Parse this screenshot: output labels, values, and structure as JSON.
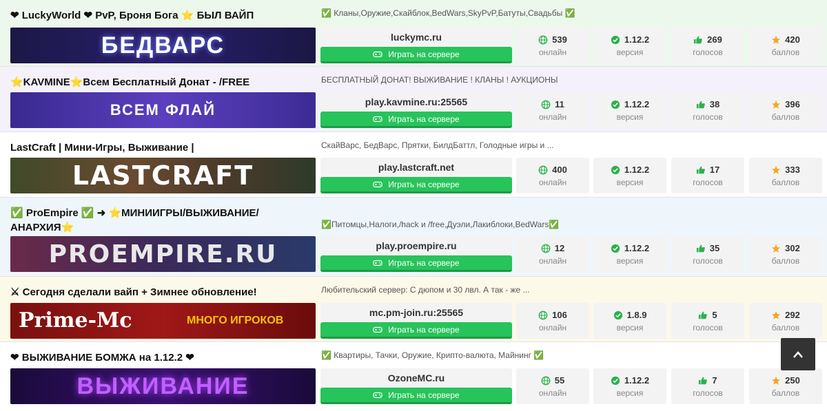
{
  "play_label": "Играть на сервере",
  "labels": {
    "online": "онлайн",
    "version": "версия",
    "votes": "голосов",
    "points": "баллов"
  },
  "colors": {
    "green": "#27c35b",
    "row1_bg": "#edf8ed",
    "row2_bg": "#f5f1fb",
    "row4_bg": "#eef6fb",
    "row5_bg": "#fdf9e8"
  },
  "servers": [
    {
      "title": "❤ LuckyWorld ❤ PvP, Броня Бога ⭐ БЫЛ ВАЙП",
      "desc": "✅ Кланы,Оружие,Скайблок,BedWars,SkyPvP,Батуты,Свадьбы ✅",
      "banner_text": "БЕДВАРС",
      "ip": "luckymc.ru",
      "online": "539",
      "version": "1.12.2",
      "votes": "269",
      "points": "420"
    },
    {
      "title": "⭐KAVMINE⭐Всем Бесплатный Донат - /FREE",
      "desc": "БЕСПЛАТНЫЙ ДОНАТ! ВЫЖИВАНИЕ ! КЛАНЫ ! АУКЦИОНЫ",
      "banner_text": "ВСЕМ ФЛАЙ",
      "ip": "play.kavmine.ru:25565",
      "online": "11",
      "version": "1.12.2",
      "votes": "38",
      "points": "396"
    },
    {
      "title": "LastCraft | Мини-Игры, Выживание |",
      "desc": "СкайВарс, БедВарс, Прятки, БилдБаттл, Голодные игры и ...",
      "banner_text": "LASTCRAFT",
      "ip": "play.lastcraft.net",
      "online": "400",
      "version": "1.12.2",
      "votes": "17",
      "points": "333"
    },
    {
      "title": "✅ ProEmpire ✅ ➜ ⭐МИНИИГРЫ/ВЫЖИВАНИЕ/ АНАРХИЯ⭐",
      "desc": "✅Питомцы,Налоги,/hack и /free,Дуэли,Лакиблоки,BedWars✅",
      "banner_text": "PROEMPIRE.RU",
      "ip": "play.proempire.ru",
      "online": "12",
      "version": "1.12.2",
      "votes": "35",
      "points": "302"
    },
    {
      "title": "⚔ Сегодня сделали вайп + Зимнее обновление!",
      "desc": "Любительский сервер: С дюпом и 30 лвл. А так - же ...",
      "banner_text": "Prime-Mc",
      "banner_text2": "МНОГО ИГРОКОВ",
      "ip": "mc.pm-join.ru:25565",
      "online": "106",
      "version": "1.8.9",
      "votes": "5",
      "points": "292"
    },
    {
      "title": "❤ ВЫЖИВАНИЕ БОМЖА на 1.12.2 ❤",
      "desc": "✅ Квартиры, Тачки, Оружие, Крипто-валюта, Майнинг ✅",
      "banner_text": "ВЫЖИВАНИЕ",
      "ip": "OzoneMC.ru",
      "online": "55",
      "version": "1.12.2",
      "votes": "7",
      "points": "250"
    }
  ]
}
